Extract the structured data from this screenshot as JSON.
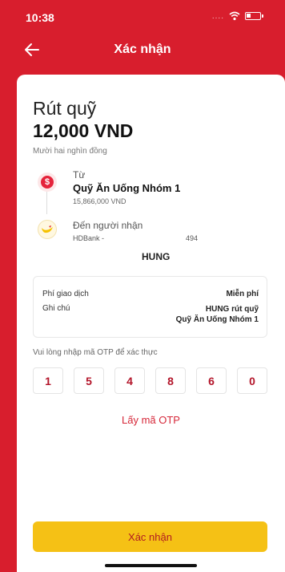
{
  "status_bar": {
    "time": "10:38",
    "signal": "....",
    "icons": [
      "wifi-icon",
      "battery-icon"
    ]
  },
  "header": {
    "title": "Xác nhận",
    "back_icon": "arrow-left-icon"
  },
  "withdraw": {
    "title": "Rút quỹ",
    "amount": "12,000 VND",
    "amount_in_words": "Mười hai nghìn đồng"
  },
  "source": {
    "label": "Từ",
    "name": "Quỹ Ăn Uống Nhóm 1",
    "balance": "15,866,000 VND",
    "icon": "dollar-coin-icon"
  },
  "destination": {
    "label": "Đến người nhận",
    "bank": "HDBank -",
    "account_tail": "494",
    "recipient": "HUNG",
    "icon": "hdbank-logo-icon"
  },
  "details": {
    "fee_label": "Phí giao dịch",
    "fee_value": "Miễn phí",
    "note_label": "Ghi chú",
    "note_line1": "HUNG rút quỹ",
    "note_line2": "Quỹ Ăn Uống Nhóm 1"
  },
  "otp": {
    "instruction": "Vui lòng nhập mã OTP để xác thực",
    "digits": [
      "1",
      "5",
      "4",
      "8",
      "6",
      "0"
    ],
    "get_otp_label": "Lấy mã OTP"
  },
  "footer": {
    "confirm_label": "Xác nhận"
  },
  "colors": {
    "brand_red": "#d81e2d",
    "button_yellow": "#f5c115",
    "otp_red": "#b3152a"
  }
}
